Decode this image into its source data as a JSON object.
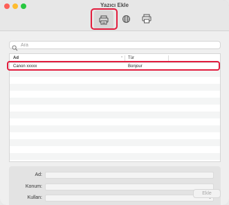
{
  "window": {
    "title": "Yazıcı Ekle"
  },
  "toolbar": {
    "items": [
      {
        "name": "default-printers",
        "icon": "printer-icon",
        "selected": true
      },
      {
        "name": "ip-printers",
        "icon": "globe-icon",
        "selected": false
      },
      {
        "name": "windows-printers",
        "icon": "printer-alt-icon",
        "selected": false
      }
    ]
  },
  "search": {
    "placeholder": "Ara",
    "value": ""
  },
  "table": {
    "columns": [
      "Ad",
      "Tür"
    ],
    "rows": [
      {
        "name": "Canon xxxxx",
        "type": "Bonjour"
      }
    ]
  },
  "details": {
    "name_label": "Ad:",
    "location_label": "Konum:",
    "use_label": "Kullan:",
    "name_value": "",
    "location_value": "",
    "use_value": ""
  },
  "footer": {
    "add_label": "Ekle"
  },
  "colors": {
    "highlight": "#e21c3d",
    "close": "#fd5f57",
    "minimize": "#febc2e",
    "zoom": "#28c840"
  }
}
